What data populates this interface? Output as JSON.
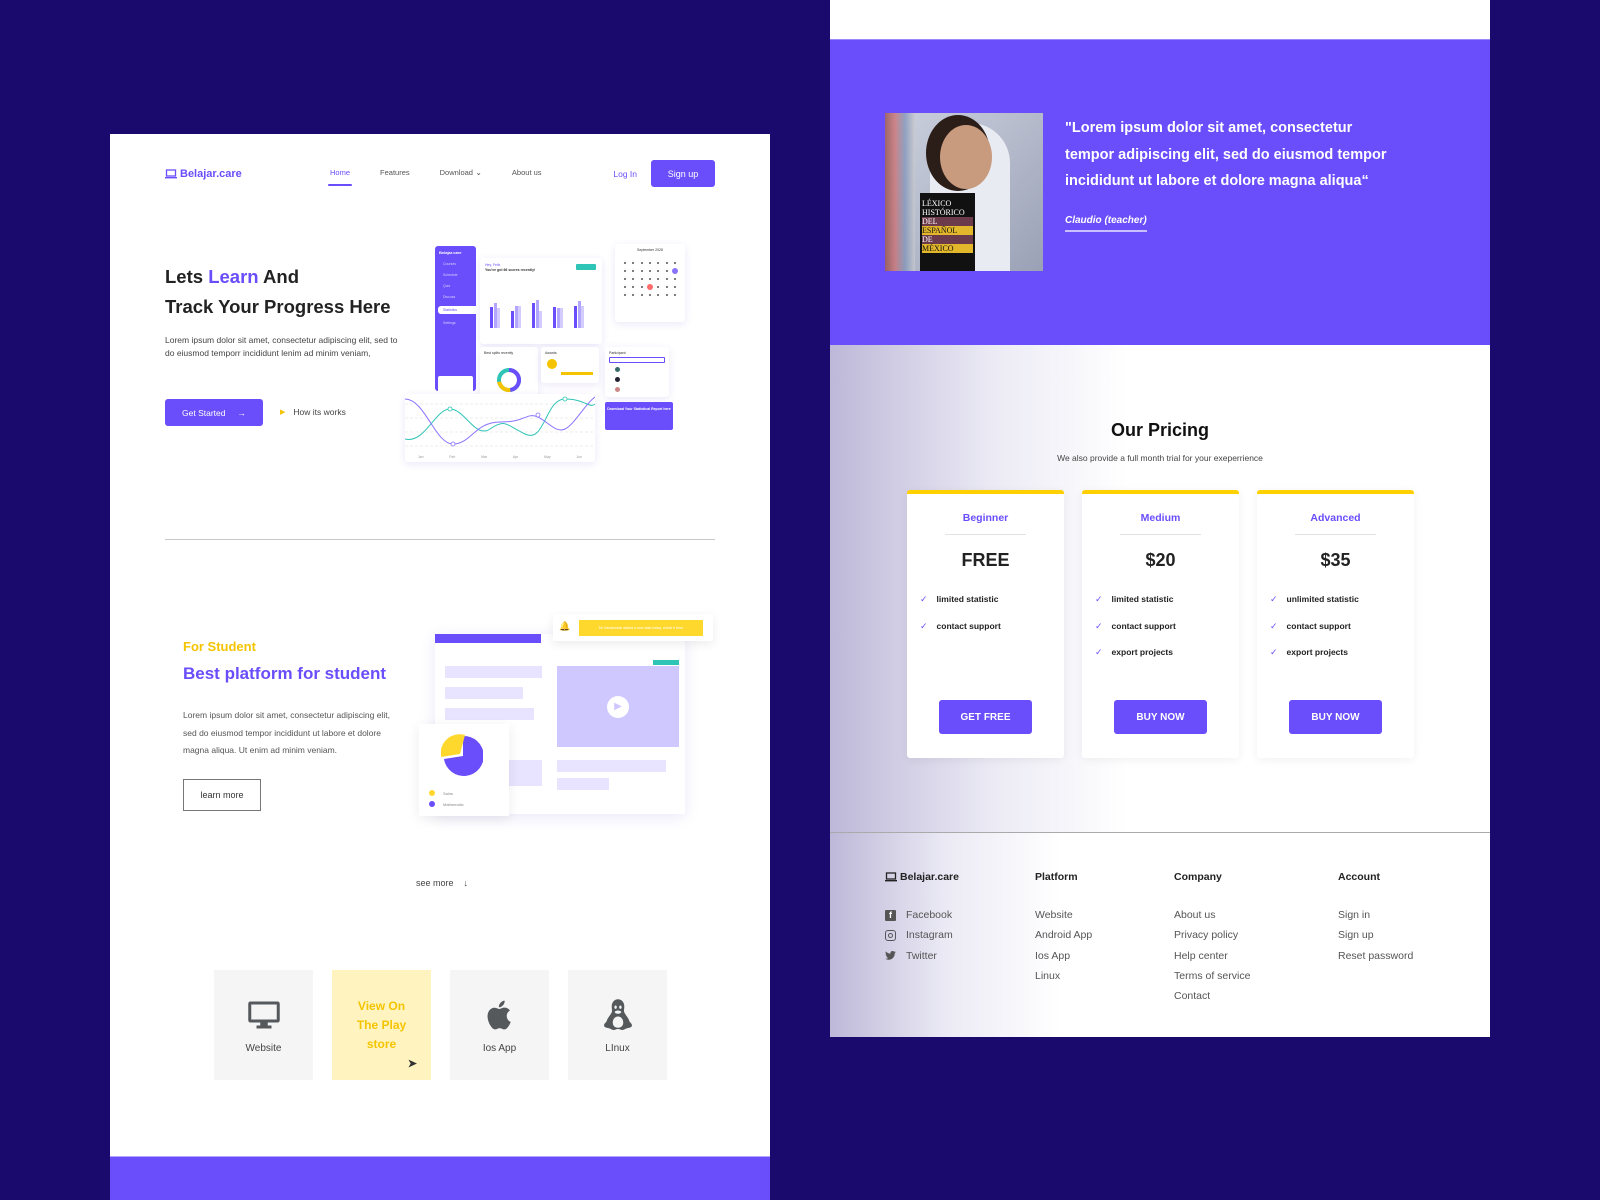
{
  "left_page": {
    "nav": {
      "brand": "Belajar.care",
      "links": [
        "Home",
        "Features",
        "Download",
        "About us"
      ],
      "active": "Home",
      "login": "Log In",
      "signup": "Sign up"
    },
    "hero": {
      "title_prefix": "Lets ",
      "title_accent": "Learn",
      "title_suffix": " And",
      "title_line2": "Track Your Progress Here",
      "description": "Lorem ipsum dolor sit amet, consectetur adipiscing elit, sed to do eiusmod temporr incididunt lenim ad minim veniam,",
      "primary_button": "Get Started",
      "secondary_link": "How its works"
    },
    "dashboard_mock": {
      "brand": "Belajar.care",
      "sidebar": [
        "Courses",
        "Schedule",
        "Quiz",
        "Discuss",
        "Statistics",
        "Settings"
      ],
      "greeting": "Hey, Felix",
      "headline": "You've got 66 scores recently!",
      "calendar_title": "September 2028",
      "splits_title": "Best splits recently",
      "awards_title": "Awards",
      "participant_title": "Participant",
      "download_report": "Download Your Statistical Report here",
      "line_months": [
        "Jan",
        "Feb",
        "Mar",
        "Apr",
        "May",
        "Jun"
      ]
    },
    "student": {
      "kicker": "For Student",
      "title": "Best platform for student",
      "description": "Lorem ipsum dolor sit amet, consectetur adipiscing elit, sed do eiusmod tempor incididunt ut labore et dolore magna aliqua. Ut enim ad minim veniam.",
      "button": "learn more",
      "notification": "Mr Sarwendah added a new task today, check it here",
      "legend": [
        "Sains",
        "Mathematic"
      ]
    },
    "see_more": "see more",
    "platforms": [
      {
        "label": "Website",
        "icon": "monitor-icon"
      },
      {
        "label": "View On The Play store",
        "icon": "",
        "highlight": true
      },
      {
        "label": "Ios App",
        "icon": "apple-icon"
      },
      {
        "label": "LInux",
        "icon": "linux-icon"
      }
    ]
  },
  "right_page": {
    "testimonial": {
      "quote": "\"Lorem ipsum dolor sit amet, consectetur tempor adipiscing elit, sed do eiusmod tempor incididunt ut labore et dolore magna aliqua“",
      "author": "Claudio (teacher)",
      "book_text": [
        "LÉXICO",
        "HISTÓRICO",
        "DEL",
        "ESPAÑOL",
        "DE",
        "MÉXICO"
      ]
    },
    "pricing": {
      "title": "Our Pricing",
      "subtitle": "We also provide a full month trial for your exeperrience",
      "plans": [
        {
          "tier": "Beginner",
          "price": "FREE",
          "features": [
            "limited statistic",
            "contact support"
          ],
          "cta": "GET FREE"
        },
        {
          "tier": "Medium",
          "price": "$20",
          "features": [
            "limited statistic",
            "contact support",
            "export projects"
          ],
          "cta": "BUY NOW"
        },
        {
          "tier": "Advanced",
          "price": "$35",
          "features": [
            "unlimited statistic",
            "contact support",
            "export projects"
          ],
          "cta": "BUY NOW"
        }
      ]
    },
    "footer": {
      "brand": "Belajar.care",
      "social": [
        {
          "label": "Facebook",
          "icon": "facebook-icon"
        },
        {
          "label": "Instagram",
          "icon": "instagram-icon"
        },
        {
          "label": "Twitter",
          "icon": "twitter-icon"
        }
      ],
      "columns": [
        {
          "title": "Platform",
          "links": [
            "Website",
            "Android App",
            "Ios App",
            "Linux"
          ]
        },
        {
          "title": "Company",
          "links": [
            "About us",
            "Privacy policy",
            "Help center",
            "Terms of service",
            "Contact"
          ]
        },
        {
          "title": "Account",
          "links": [
            "Sign in",
            "Sign up",
            "Reset password"
          ]
        }
      ]
    }
  },
  "colors": {
    "brand": "#6a4dfb",
    "accent_yellow": "#f5c400",
    "background": "#1a0a6e",
    "teal": "#2ec4b6"
  }
}
